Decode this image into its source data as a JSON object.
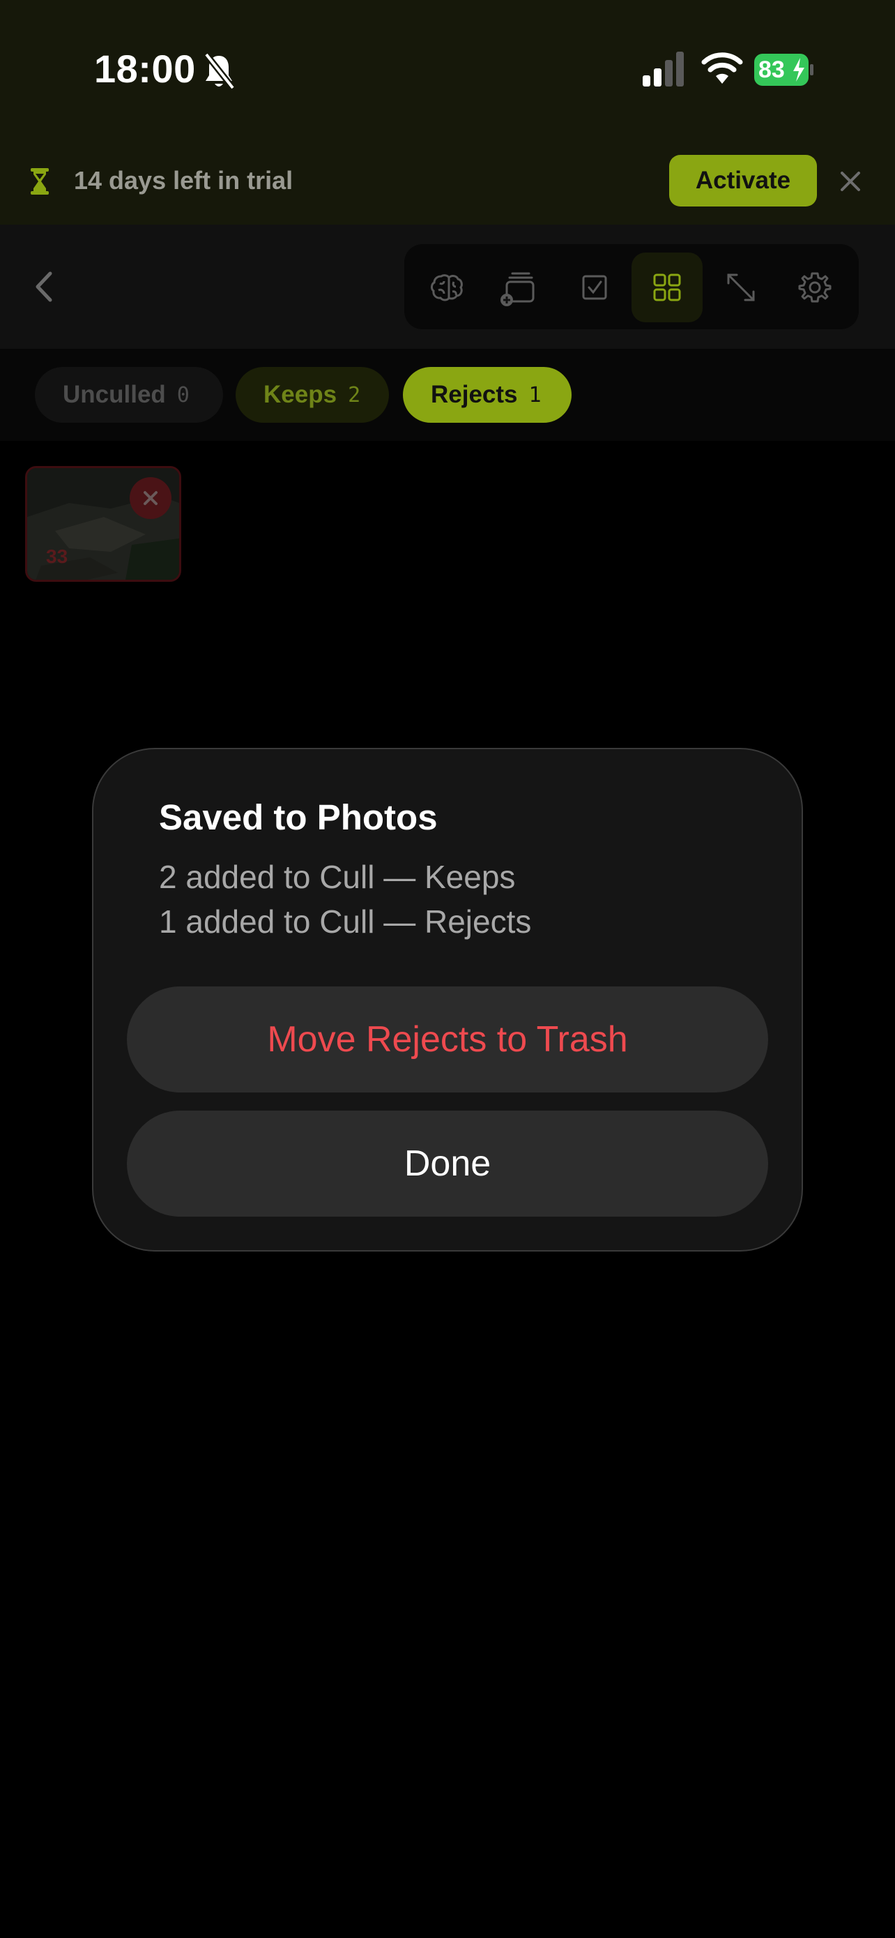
{
  "status_bar": {
    "time": "18:00",
    "battery": "83"
  },
  "trial_banner": {
    "text": "14 days left in trial",
    "activate_label": "Activate"
  },
  "toolbar": {
    "tools": [
      "brain-icon",
      "stack-add-icon",
      "checkbox-icon",
      "grid-icon",
      "expand-icon",
      "gear-icon"
    ],
    "active_tool": "grid-icon",
    "accent_color": "#8aa612"
  },
  "tabs": {
    "unculled": {
      "label": "Unculled",
      "count": "0"
    },
    "keeps": {
      "label": "Keeps",
      "count": "2"
    },
    "rejects": {
      "label": "Rejects",
      "count": "1"
    },
    "selected": "Rejects"
  },
  "thumbnail": {
    "number": "33"
  },
  "dialog": {
    "title": "Saved to Photos",
    "line1": "2 added to Cull — Keeps",
    "line2": "1 added to Cull — Rejects",
    "trash_label": "Move Rejects to Trash",
    "done_label": "Done",
    "destructive_color": "#ee4a4f"
  }
}
